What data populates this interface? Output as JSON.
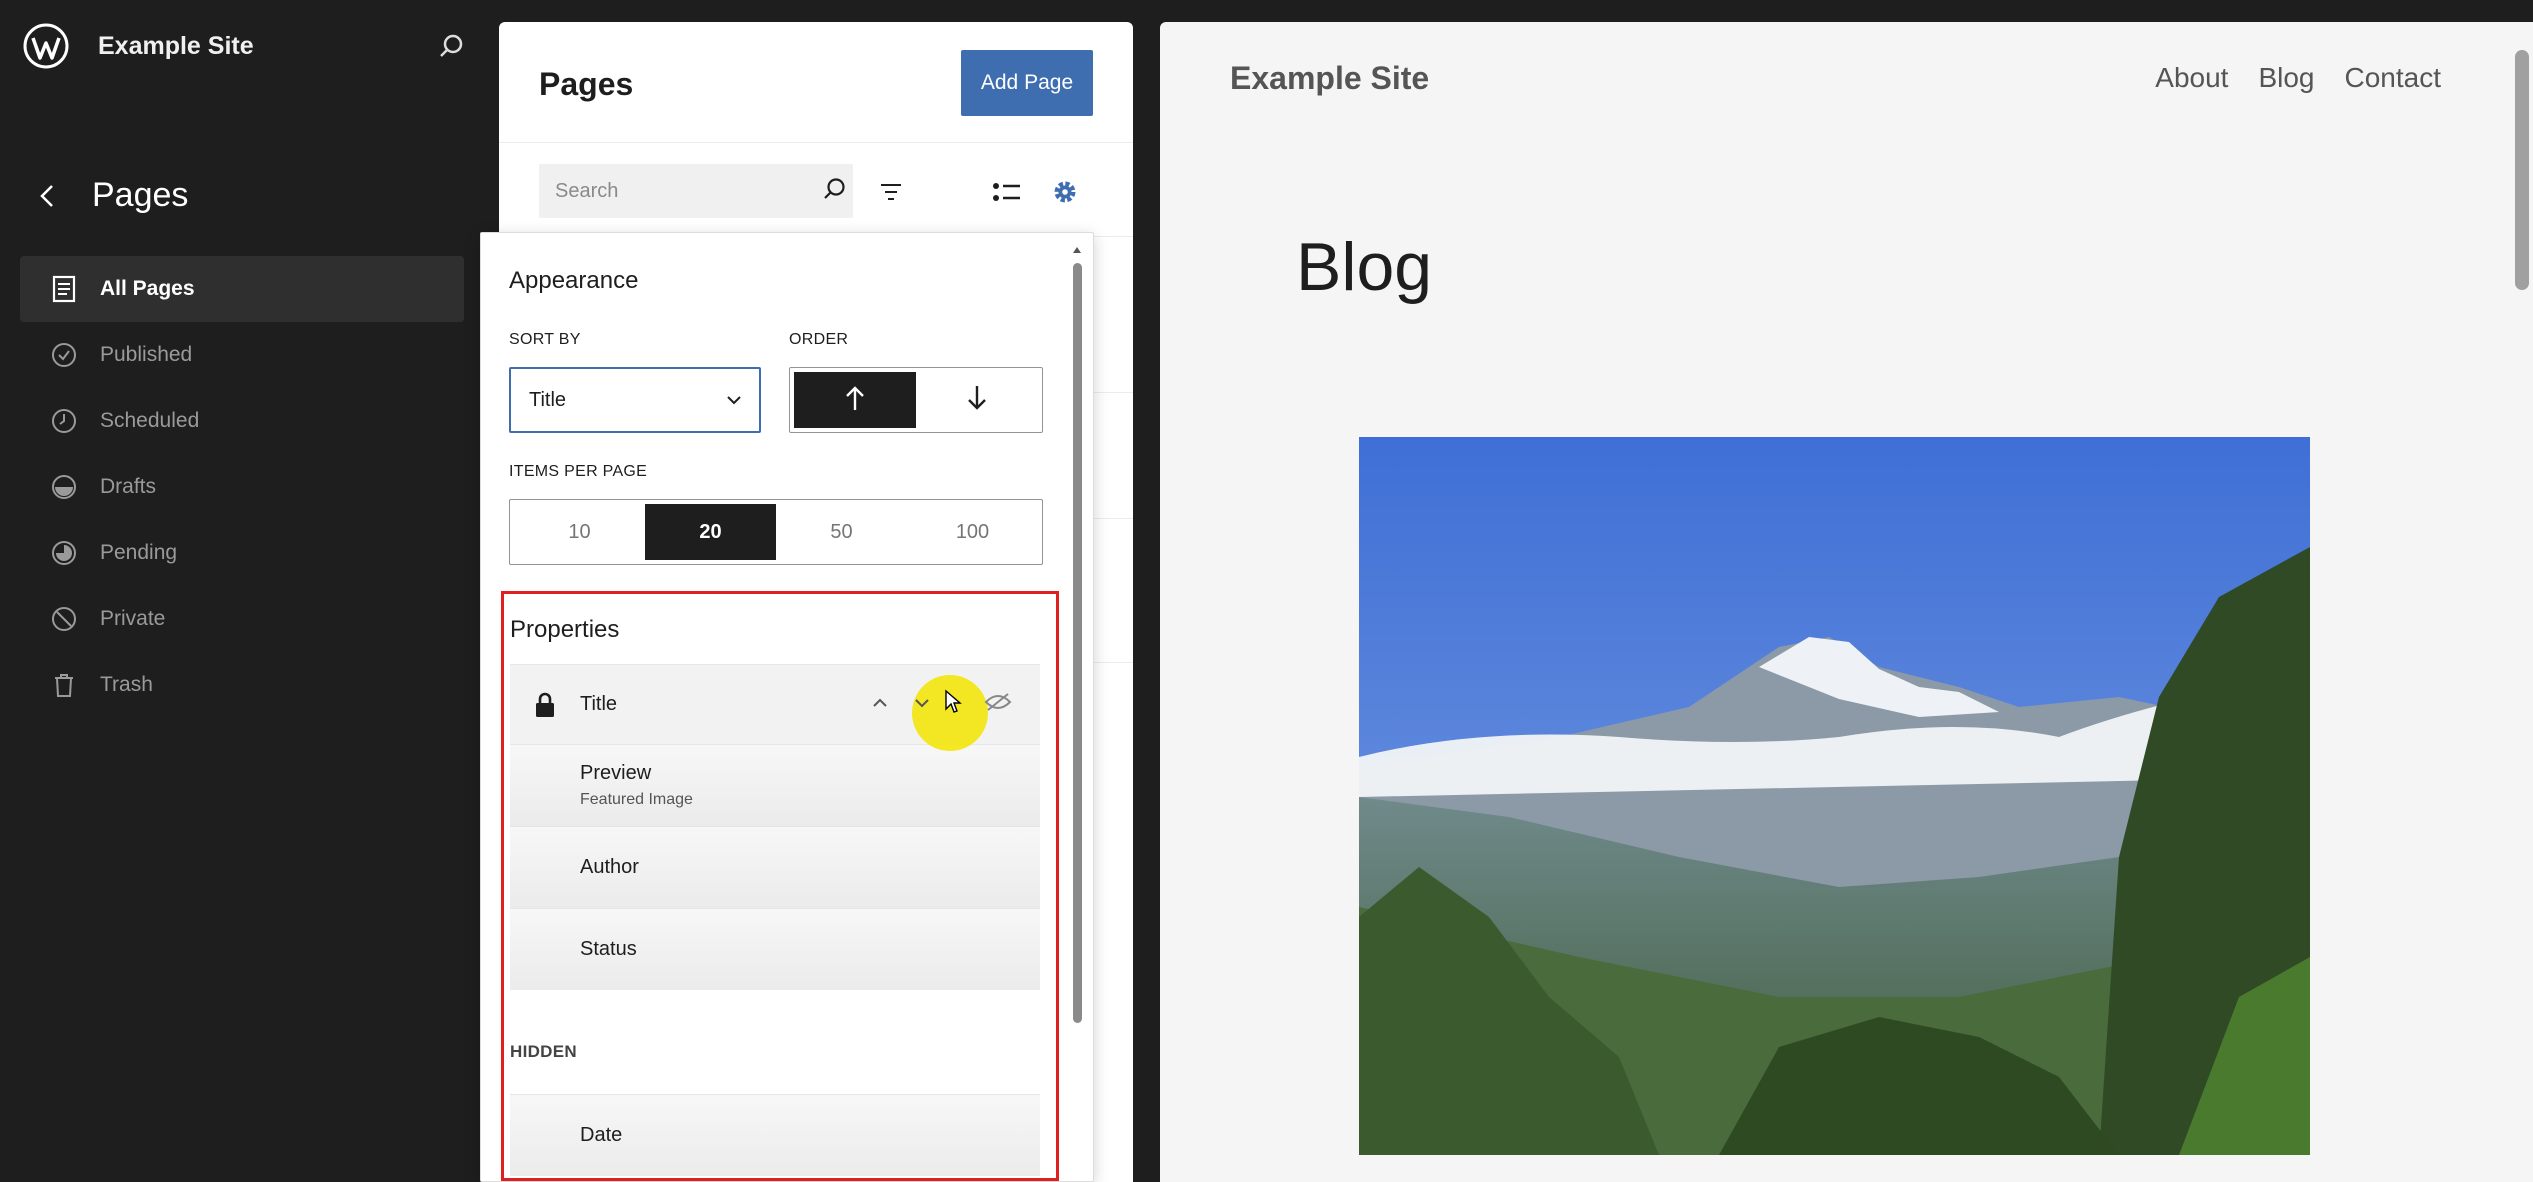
{
  "sidebar": {
    "site_name": "Example Site",
    "section_title": "Pages",
    "items": [
      {
        "label": "All Pages"
      },
      {
        "label": "Published"
      },
      {
        "label": "Scheduled"
      },
      {
        "label": "Drafts"
      },
      {
        "label": "Pending"
      },
      {
        "label": "Private"
      },
      {
        "label": "Trash"
      }
    ]
  },
  "list_panel": {
    "title": "Pages",
    "add_button": "Add Page",
    "search_placeholder": "Search"
  },
  "appearance": {
    "title": "Appearance",
    "sort_by_label": "SORT BY",
    "sort_by_value": "Title",
    "order_label": "ORDER",
    "order_selected": "ascending",
    "items_per_page_label": "ITEMS PER PAGE",
    "items_per_page_options": [
      "10",
      "20",
      "50",
      "100"
    ],
    "items_per_page_selected": "20"
  },
  "properties": {
    "title": "Properties",
    "title_field": "Title",
    "visible_fields": [
      {
        "label": "Preview",
        "sub": "Featured Image"
      },
      {
        "label": "Author"
      },
      {
        "label": "Status"
      }
    ],
    "hidden_label": "HIDDEN",
    "hidden_fields": [
      {
        "label": "Date"
      }
    ]
  },
  "preview": {
    "site_name": "Example Site",
    "nav": [
      "About",
      "Blog",
      "Contact"
    ],
    "heading": "Blog"
  },
  "colors": {
    "accent": "#3e6eb0",
    "highlight_border": "#e02020",
    "cursor_halo": "#f2e610"
  }
}
